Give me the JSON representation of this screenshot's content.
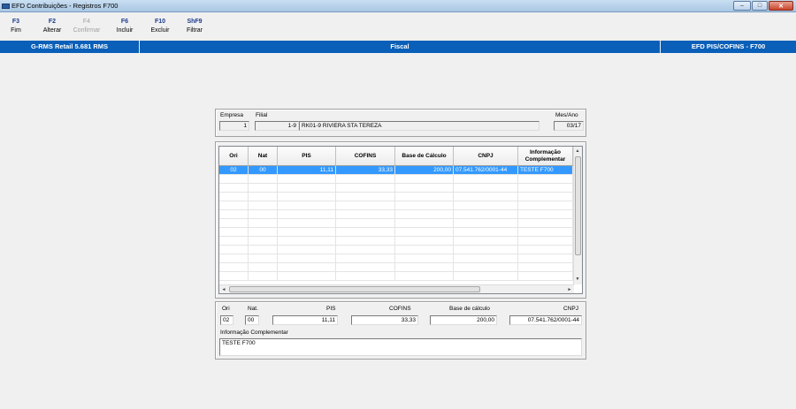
{
  "window": {
    "title": "EFD Contribuições - Registros F700"
  },
  "toolbar": {
    "items": [
      {
        "key": "F3",
        "label": "Fim"
      },
      {
        "key": "F2",
        "label": "Alterar"
      },
      {
        "key": "F4",
        "label": "Confirmar"
      },
      {
        "key": "F6",
        "label": "Incluir"
      },
      {
        "key": "F10",
        "label": "Excluir"
      },
      {
        "key": "ShF9",
        "label": "Filtrar"
      }
    ]
  },
  "statusbar": {
    "system": "G-RMS Retail 5.681 RMS",
    "module": "Fiscal",
    "screen": "EFD PIS/COFINS - F700"
  },
  "header": {
    "empresa_label": "Empresa",
    "empresa_value": "1",
    "filial_label": "Filial",
    "filial_code": "1-9",
    "filial_name": "RK01-9 RIVIERA STA TEREZA",
    "mesano_label": "Mes/Ano",
    "mesano_value": "03/17"
  },
  "grid": {
    "columns": [
      "Ori",
      "Nat",
      "PIS",
      "COFINS",
      "Base de Cálculo",
      "CNPJ",
      "Informação Complementar"
    ],
    "rows": [
      [
        "02",
        "00",
        "11,11",
        "33,33",
        "200,00",
        "07.541.762/0001-44",
        "TESTE F700"
      ]
    ],
    "scroll_up": "▲",
    "scroll_down": "▼",
    "scroll_left": "◄",
    "scroll_right": "►"
  },
  "detail": {
    "ori_label": "Ori",
    "ori_value": "02",
    "nat_label": "Nat.",
    "nat_value": "00",
    "pis_label": "PIS",
    "pis_value": "11,11",
    "cofins_label": "COFINS",
    "cofins_value": "33,33",
    "base_label": "Base de cálculo",
    "base_value": "200,00",
    "cnpj_label": "CNPJ",
    "cnpj_value": "07.541.762/0001-44",
    "info_label": "Informação Complementar",
    "info_value": "TESTE F700"
  }
}
